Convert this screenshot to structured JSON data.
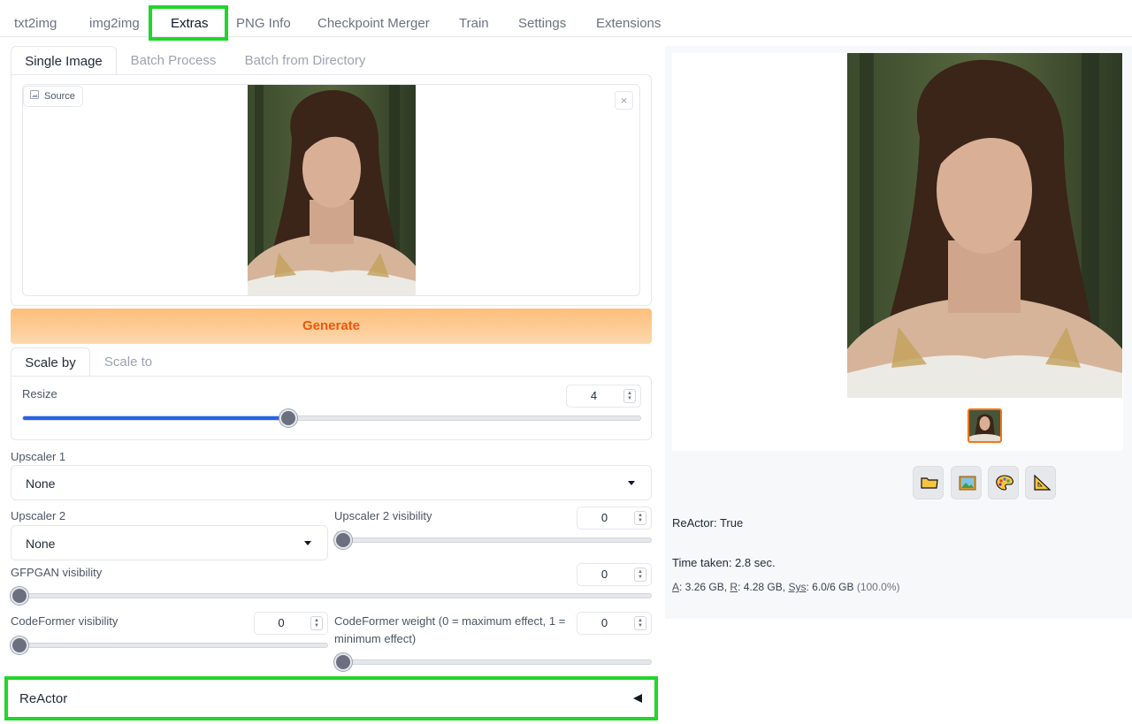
{
  "top_tabs": [
    "txt2img",
    "img2img",
    "Extras",
    "PNG Info",
    "Checkpoint Merger",
    "Train",
    "Settings",
    "Extensions"
  ],
  "active_top_tab": "Extras",
  "sub_tabs": [
    "Single Image",
    "Batch Process",
    "Batch from Directory"
  ],
  "source_label": "Source",
  "close_symbol": "×",
  "generate_label": "Generate",
  "scale_tabs": [
    "Scale by",
    "Scale to"
  ],
  "resize": {
    "label": "Resize",
    "value": "4",
    "fraction": 0.42
  },
  "upscaler1": {
    "label": "Upscaler 1",
    "value": "None"
  },
  "upscaler2": {
    "label": "Upscaler 2",
    "value": "None"
  },
  "upscaler2_visibility": {
    "label": "Upscaler 2 visibility",
    "value": "0",
    "fraction": 0
  },
  "gfpgan": {
    "label": "GFPGAN visibility",
    "value": "0",
    "fraction": 0
  },
  "codeformer_visibility": {
    "label": "CodeFormer visibility",
    "value": "0",
    "fraction": 0
  },
  "codeformer_weight": {
    "label_line1": "CodeFormer weight (0 = maximum effect, 1 =",
    "label_line2": "minimum effect)",
    "value": "0",
    "fraction": 0
  },
  "reactor_accordion": "ReActor",
  "output": {
    "reactor_status": "ReActor: True",
    "time_taken": "Time taken: 2.8 sec.",
    "mem": {
      "a_key": "A",
      "a_val": ": 3.26 GB, ",
      "r_key": "R",
      "r_val": ": 4.28 GB, ",
      "sys_key": "Sys",
      "sys_val": ": 6.0/6 GB ",
      "sys_pct": "(100.0%)"
    }
  },
  "tool_buttons": [
    "folder-icon",
    "image-icon",
    "palette-icon",
    "ruler-icon"
  ],
  "colors": {
    "accent_orange": "#ea580c",
    "highlight_green": "#22d52a",
    "slider_blue": "#2563eb",
    "selected_thumb_border": "#f97316"
  }
}
